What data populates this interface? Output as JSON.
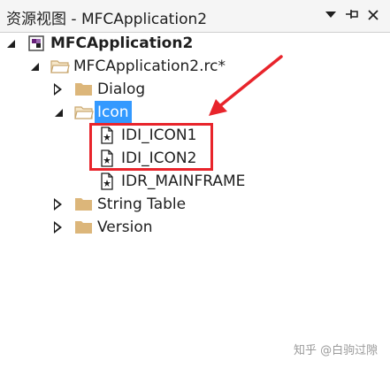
{
  "window": {
    "title": "资源视图 - MFCApplication2",
    "dropdown_icon": "chevron-down-icon",
    "pin_icon": "pin-icon",
    "close_icon": "close-icon"
  },
  "tree": {
    "project": {
      "label": "MFCApplication2",
      "expanded": true
    },
    "rc_file": {
      "label": "MFCApplication2.rc*",
      "expanded": true
    },
    "folders": [
      {
        "label": "Dialog",
        "expanded": false
      },
      {
        "label": "Icon",
        "expanded": true,
        "selected": true
      },
      {
        "label": "String Table",
        "expanded": false
      },
      {
        "label": "Version",
        "expanded": false
      }
    ],
    "icon_resources": [
      "IDI_ICON1",
      "IDI_ICON2",
      "IDR_MAINFRAME"
    ]
  },
  "annotation": {
    "color": "#e8242b"
  },
  "colors": {
    "selection": "#3399ff",
    "folder": "#dcb67a"
  },
  "watermark": "知乎 @白驹过隙"
}
